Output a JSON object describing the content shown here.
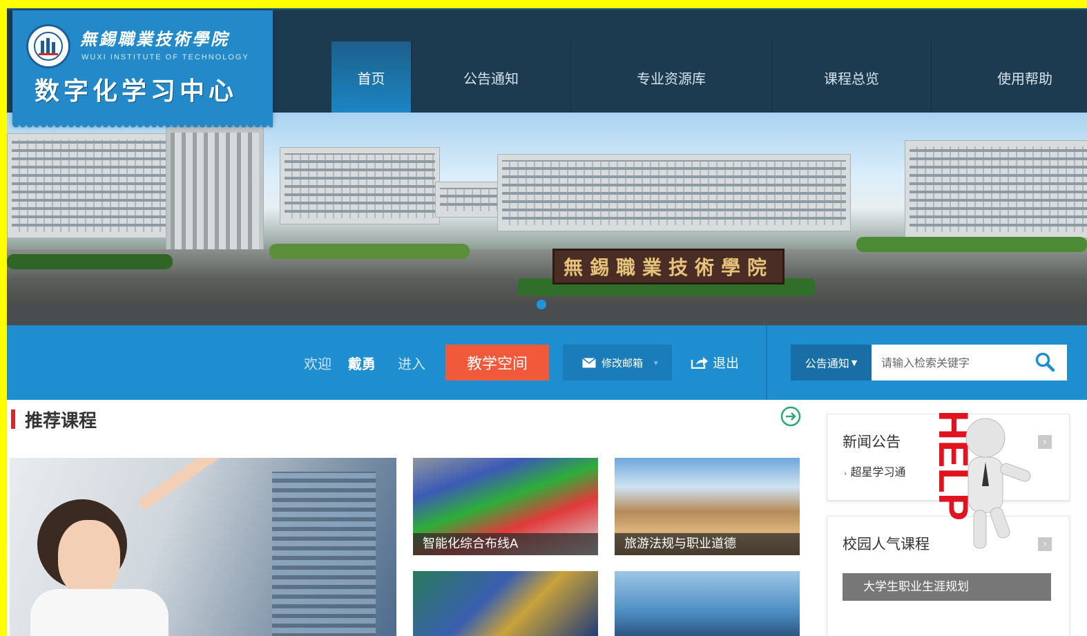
{
  "logo": {
    "school_cn": "無錫職業技術學院",
    "school_en": "WUXI INSTITUTE OF TECHNOLOGY",
    "title": "数字化学习中心"
  },
  "nav": [
    {
      "label": "首页",
      "active": true
    },
    {
      "label": "公告通知",
      "active": false
    },
    {
      "label": "专业资源库",
      "active": false
    },
    {
      "label": "课程总览",
      "active": false
    },
    {
      "label": "使用帮助",
      "active": false
    }
  ],
  "banner": {
    "gate_text": "無錫職業技術學院",
    "slides": 1,
    "current_slide": 1
  },
  "userbar": {
    "welcome": "欢迎",
    "username": "戴勇",
    "enter": "进入",
    "space_button": "教学空间",
    "mail_button": "修改邮箱",
    "logout": "退出",
    "search_type": "公告通知",
    "search_placeholder": "请输入检索关键字"
  },
  "recommended": {
    "title": "推荐课程",
    "courses": [
      {
        "title": "",
        "image": "student-lab-photo"
      },
      {
        "title": "智能化综合布线A",
        "image": "network-cables-photo"
      },
      {
        "title": "旅游法规与职业道德",
        "image": "arena-photo"
      },
      {
        "title": "",
        "image": "circuit-board-photo"
      },
      {
        "title": "",
        "image": "world-network-photo"
      }
    ]
  },
  "sidebar": {
    "news_title": "新闻公告",
    "news_items": [
      {
        "text": "超星学习通"
      }
    ],
    "popular_title": "校园人气课程",
    "popular_first": "大学生职业生涯规划",
    "help_text": "HELP"
  },
  "colors": {
    "nav_bg": "#1d3b50",
    "accent_blue": "#1f8ed1",
    "space_button": "#f05a3a",
    "section_mark": "#d12a2a"
  }
}
